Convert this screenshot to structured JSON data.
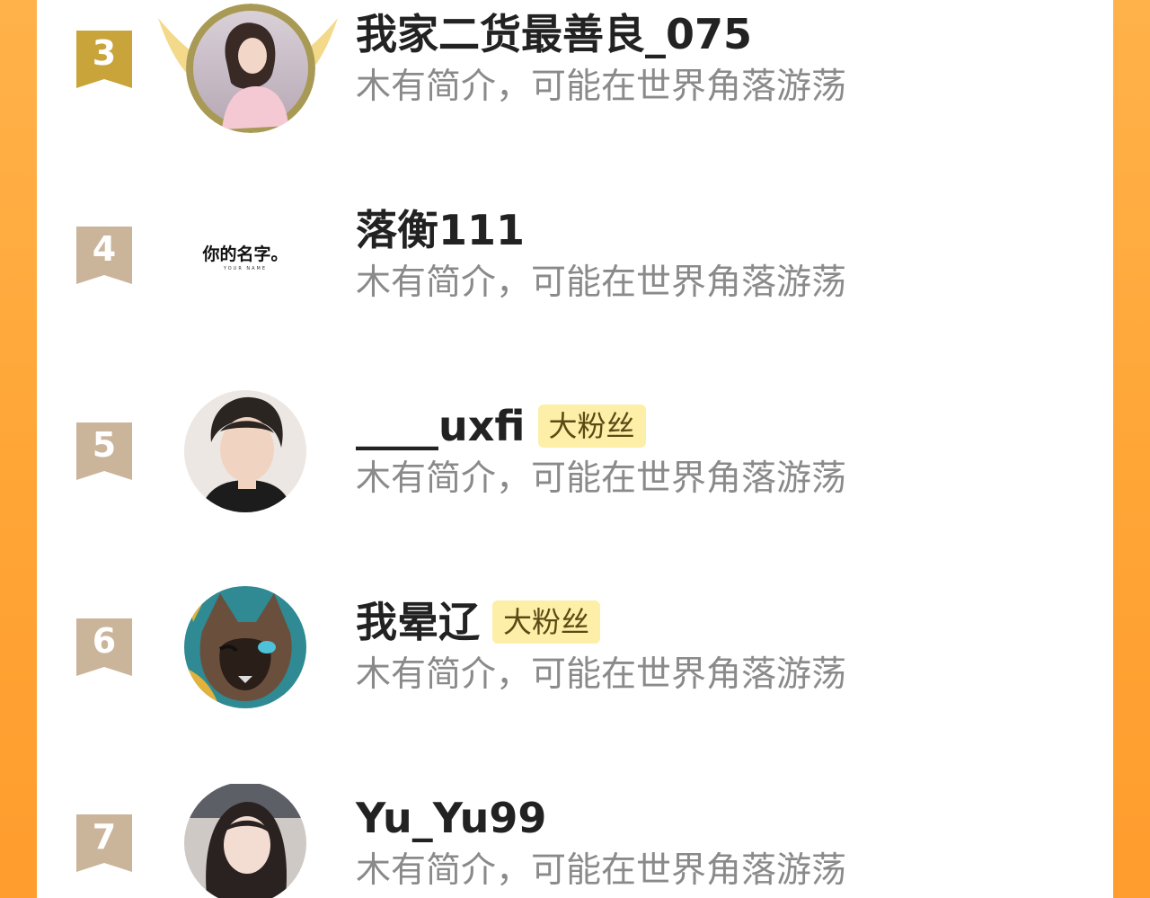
{
  "colors": {
    "background": "#ffa637",
    "panel": "#ffffff",
    "rank_gold": "#c9a43a",
    "rank_default": "#cbb59a",
    "name": "#222222",
    "bio": "#8a8a8a",
    "fan_badge_bg": "#fdefa8"
  },
  "ranking": [
    {
      "rank": "3",
      "name": "我家二货最善良_075",
      "bio": "木有简介，可能在世界角落游荡",
      "badge": "",
      "avatar": "girl-photo-with-gold-wing-frame"
    },
    {
      "rank": "4",
      "name": "落衡111",
      "bio": "木有简介，可能在世界角落游荡",
      "badge": "",
      "avatar": "text-card",
      "avatar_text": "你的名字。",
      "avatar_subtext": "YOUR NAME"
    },
    {
      "rank": "5",
      "name": "____uxfi",
      "bio": "木有简介，可能在世界角落游荡",
      "badge": "大粉丝",
      "avatar": "young-man-photo"
    },
    {
      "rank": "6",
      "name": "我晕辽",
      "bio": "木有简介，可能在世界角落游荡",
      "badge": "大粉丝",
      "avatar": "siamese-cat-illustration"
    },
    {
      "rank": "7",
      "name": "Yu_Yu99",
      "bio": "木有简介，可能在世界角落游荡",
      "badge": "",
      "avatar": "woman-selfie-photo"
    }
  ]
}
